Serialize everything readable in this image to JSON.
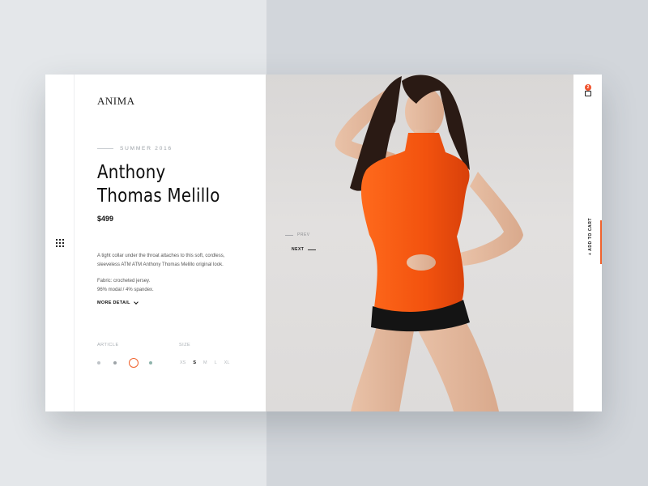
{
  "brand": {
    "logo": "ANIMA"
  },
  "product": {
    "season": "SUMMER 2016",
    "title_line1": "Anthony",
    "title_line2": "Thomas Melillo",
    "price": "$499",
    "description": "A tight collar under the throat attaches to this soft, cordless, sleeveless ATM ATM Anthony Thomas Melillo original look.",
    "fabric_line1": "Fabric: crocheted jersey.",
    "fabric_line2": "96% modal / 4% spandex.",
    "more_detail": "MORE DETAIL"
  },
  "options": {
    "article_label": "ARTICLE",
    "size_label": "SIZE",
    "article_swatches": [
      {
        "color": "#bfc4c8",
        "selected": false
      },
      {
        "color": "#9ea4a8",
        "selected": false
      },
      {
        "color": "#f0622d",
        "selected": true
      },
      {
        "color": "#8fb4ac",
        "selected": false
      }
    ],
    "sizes": [
      "XS",
      "S",
      "M",
      "L",
      "XL"
    ],
    "selected_size": "S"
  },
  "gallery": {
    "prev_label": "PREV",
    "next_label": "NEXT"
  },
  "cart": {
    "count": "2",
    "add_label": "+ ADD TO CART"
  },
  "colors": {
    "accent": "#f0622d",
    "badge": "#f0522d",
    "text": "#111111"
  }
}
